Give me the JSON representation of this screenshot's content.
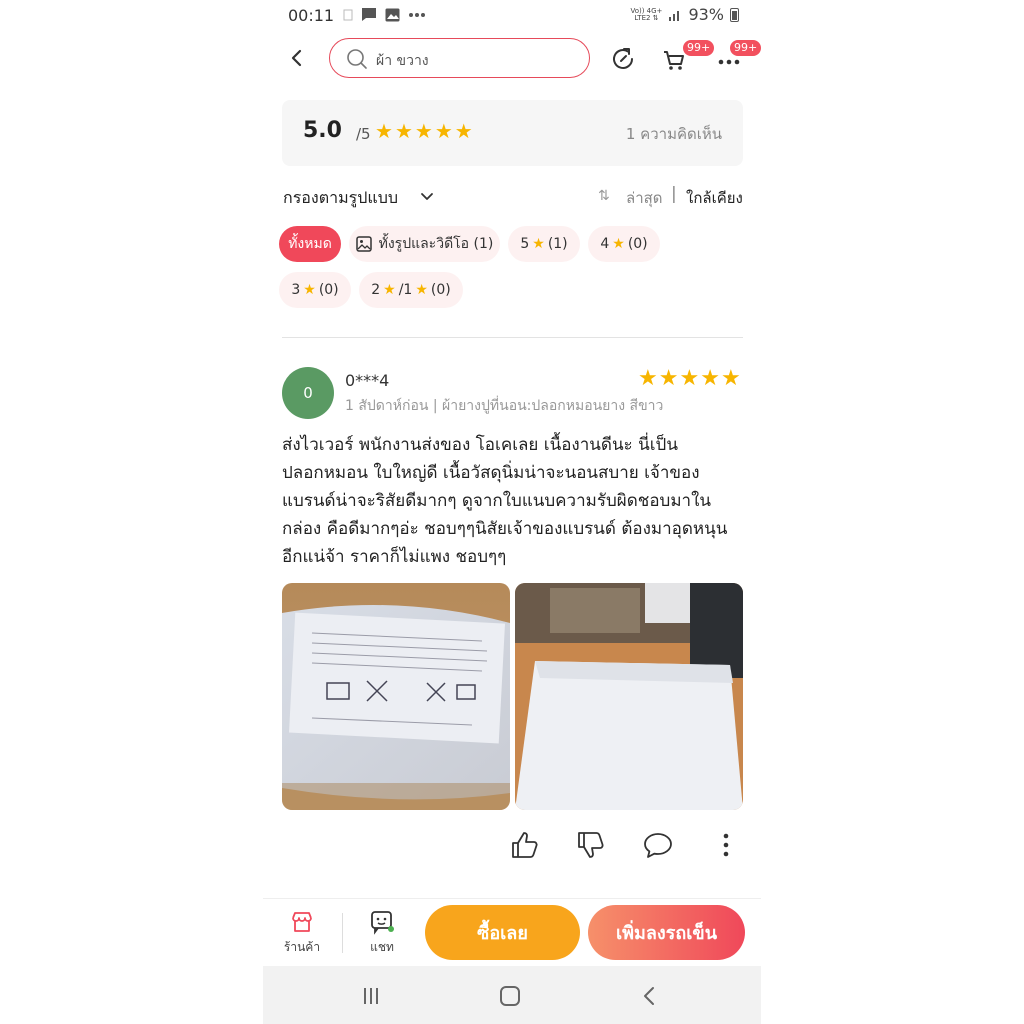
{
  "status_bar": {
    "time": "00:11",
    "network_top": "Vo)) 4G+",
    "network_bottom": "LTE2 ⇅",
    "battery": "93%"
  },
  "header": {
    "search_text": "ผ้า ขวาง",
    "cart_badge": "99+",
    "more_badge": "99+"
  },
  "rating": {
    "score": "5.0",
    "out_of": "/5",
    "stars": 5,
    "comments": "1 ความคิดเห็น"
  },
  "filter": {
    "label": "กรองตามรูปแบบ",
    "sort_icon": "⇅",
    "sort_latest": "ล่าสุด",
    "sort_separator": "|",
    "sort_nearest": "ใกล้เคียง"
  },
  "chips": {
    "all": "ทั้งหมด",
    "media": "ทั้งรูปและวิดีโอ (1)",
    "five_num": "5",
    "five_count": "(1)",
    "four_num": "4",
    "four_count": "(0)",
    "three_num": "3",
    "three_count": "(0)",
    "two_one_a": "2",
    "two_one_b": "/1",
    "two_one_count": "(0)"
  },
  "review": {
    "avatar_letter": "0",
    "username": "0***4",
    "meta": "1 สัปดาห์ก่อน | ผ้ายางปูที่นอน:ปลอกหมอนยาง สีขาว",
    "stars": 5,
    "text": "ส่งไวเวอร์ พนักงานส่งของ โอเคเลย เนื้องานดีนะ นี่เป็นปลอกหมอน ใบใหญ่ดี เนื้อวัสดุนิ่มน่าจะนอนสบาย เจ้าของแบรนด์น่าจะริสัยดีมากๆ ดูจากใบแนบความรับผิดชอบมาในกล่อง คือดีมากๆอ่ะ ชอบๆๆนิสัยเจ้าของแบรนด์ ต้องมาอุดหนุนอีกแน่จ้า ราคาก็ไม่แพง ชอบๆๆ"
  },
  "bottom_bar": {
    "shop_label": "ร้านค้า",
    "chat_label": "แชท",
    "buy_now": "ซื้อเลย",
    "add_to_cart": "เพิ่มลงรถเข็น"
  },
  "colors": {
    "accent": "#f0485a",
    "star": "#f7b500",
    "buy": "#f8a51c"
  }
}
